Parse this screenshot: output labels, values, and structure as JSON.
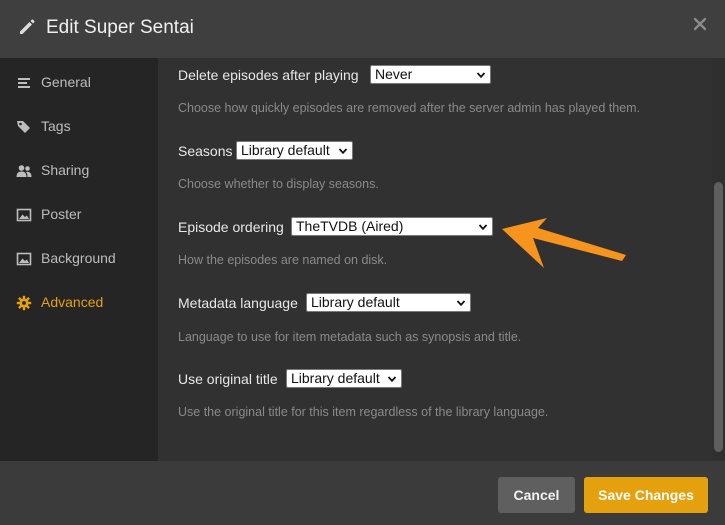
{
  "header": {
    "title": "Edit Super Sentai"
  },
  "sidebar": {
    "items": [
      {
        "label": "General",
        "icon": "menu-lines-icon"
      },
      {
        "label": "Tags",
        "icon": "tags-icon"
      },
      {
        "label": "Sharing",
        "icon": "users-icon"
      },
      {
        "label": "Poster",
        "icon": "image-icon"
      },
      {
        "label": "Background",
        "icon": "image-icon"
      },
      {
        "label": "Advanced",
        "icon": "gear-icon",
        "active": true
      }
    ]
  },
  "settings": [
    {
      "label": "Delete episodes after playing",
      "value": "Never",
      "help": "Choose how quickly episodes are removed after the server admin has played them."
    },
    {
      "label": "Seasons",
      "value": "Library default",
      "help": "Choose whether to display seasons."
    },
    {
      "label": "Episode ordering",
      "value": "TheTVDB (Aired)",
      "help": "How the episodes are named on disk."
    },
    {
      "label": "Metadata language",
      "value": "Library default",
      "help": "Language to use for item metadata such as synopsis and title."
    },
    {
      "label": "Use original title",
      "value": "Library default",
      "help": "Use the original title for this item regardless of the library language."
    }
  ],
  "footer": {
    "cancel_label": "Cancel",
    "save_label": "Save Changes"
  },
  "colors": {
    "accent": "#e5a00d",
    "arrow": "#f7941d"
  }
}
